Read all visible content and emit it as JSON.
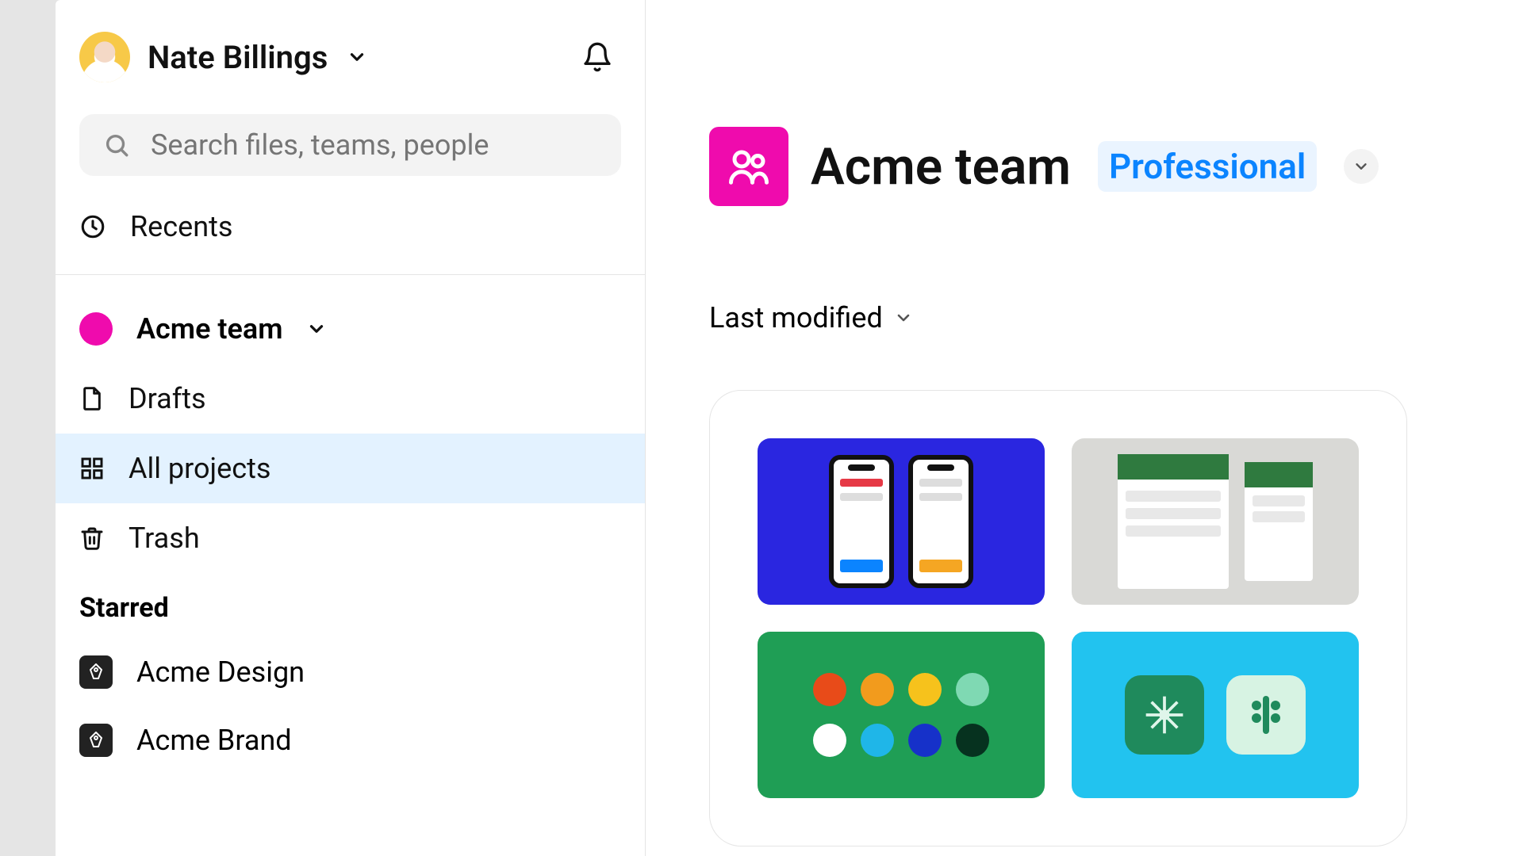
{
  "user": {
    "name": "Nate Billings"
  },
  "search": {
    "placeholder": "Search files, teams, people"
  },
  "sidebar": {
    "recents": "Recents",
    "team": "Acme team",
    "drafts": "Drafts",
    "all_projects": "All projects",
    "trash": "Trash",
    "starred_heading": "Starred",
    "starred": [
      {
        "label": "Acme Design"
      },
      {
        "label": "Acme Brand"
      }
    ]
  },
  "main": {
    "team_name": "Acme team",
    "plan": "Professional",
    "sort_label": "Last modified"
  },
  "colors": {
    "accent_pink": "#ef0bad",
    "plan_blue": "#0b84ff"
  }
}
